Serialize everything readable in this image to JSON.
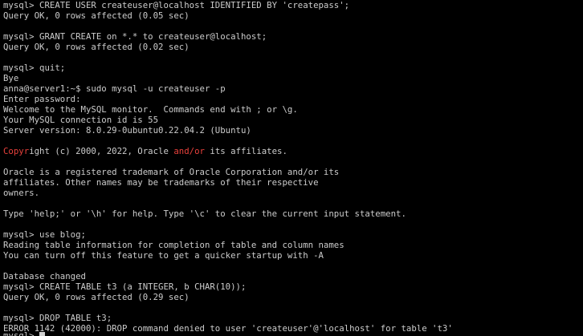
{
  "colors": {
    "background": "#000000",
    "foreground": "#cccccc",
    "highlight_red": "#e8413c"
  },
  "terminal": {
    "lines": [
      {
        "segments": [
          {
            "text": "mysql> CREATE USER createuser@localhost IDENTIFIED BY 'createpass';"
          }
        ]
      },
      {
        "segments": [
          {
            "text": "Query OK, 0 rows affected (0.05 sec)"
          }
        ]
      },
      {
        "segments": [
          {
            "text": ""
          }
        ]
      },
      {
        "segments": [
          {
            "text": "mysql> GRANT CREATE on *.* to createuser@localhost;"
          }
        ]
      },
      {
        "segments": [
          {
            "text": "Query OK, 0 rows affected (0.02 sec)"
          }
        ]
      },
      {
        "segments": [
          {
            "text": ""
          }
        ]
      },
      {
        "segments": [
          {
            "text": "mysql> quit;"
          }
        ]
      },
      {
        "segments": [
          {
            "text": "Bye"
          }
        ]
      },
      {
        "segments": [
          {
            "text": "anna@server1:~$ sudo mysql -u createuser -p"
          }
        ]
      },
      {
        "segments": [
          {
            "text": "Enter password:"
          }
        ]
      },
      {
        "segments": [
          {
            "text": "Welcome to the MySQL monitor.  Commands end with ; or \\g."
          }
        ]
      },
      {
        "segments": [
          {
            "text": "Your MySQL connection id is 55"
          }
        ]
      },
      {
        "segments": [
          {
            "text": "Server version: 8.0.29-0ubuntu0.22.04.2 (Ubuntu)"
          }
        ]
      },
      {
        "segments": [
          {
            "text": ""
          }
        ]
      },
      {
        "segments": [
          {
            "text": "Copyr",
            "color": "red"
          },
          {
            "text": "ight (c) 2000, 2022, Oracle "
          },
          {
            "text": "and/or",
            "color": "red"
          },
          {
            "text": " its affiliates."
          }
        ]
      },
      {
        "segments": [
          {
            "text": ""
          }
        ]
      },
      {
        "segments": [
          {
            "text": "Oracle is a registered trademark of Oracle Corporation and/or its"
          }
        ]
      },
      {
        "segments": [
          {
            "text": "affiliates. Other names may be trademarks of their respective"
          }
        ]
      },
      {
        "segments": [
          {
            "text": "owners."
          }
        ]
      },
      {
        "segments": [
          {
            "text": ""
          }
        ]
      },
      {
        "segments": [
          {
            "text": "Type 'help;' or '\\h' for help. Type '\\c' to clear the current input statement."
          }
        ]
      },
      {
        "segments": [
          {
            "text": ""
          }
        ]
      },
      {
        "segments": [
          {
            "text": "mysql> use blog;"
          }
        ]
      },
      {
        "segments": [
          {
            "text": "Reading table information for completion of table and column names"
          }
        ]
      },
      {
        "segments": [
          {
            "text": "You can turn off this feature to get a quicker startup with -A"
          }
        ]
      },
      {
        "segments": [
          {
            "text": ""
          }
        ]
      },
      {
        "segments": [
          {
            "text": "Database changed"
          }
        ]
      },
      {
        "segments": [
          {
            "text": "mysql> CREATE TABLE t3 (a INTEGER, b CHAR(10));"
          }
        ]
      },
      {
        "segments": [
          {
            "text": "Query OK, 0 rows affected (0.29 sec)"
          }
        ]
      },
      {
        "segments": [
          {
            "text": ""
          }
        ]
      },
      {
        "segments": [
          {
            "text": "mysql> DROP TABLE t3;"
          }
        ]
      },
      {
        "segments": [
          {
            "text": "ERROR 1142 (42000): DROP command denied to user 'createuser'@'localhost' for table 't3'"
          }
        ]
      }
    ],
    "prompt_partial": "mysql>"
  }
}
